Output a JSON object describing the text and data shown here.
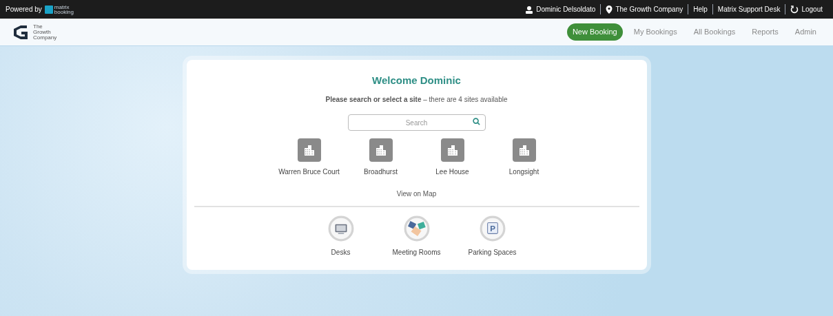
{
  "top_bar": {
    "powered_by": "Powered by",
    "brand": {
      "word1": "matrix",
      "word2": "booking"
    },
    "links": [
      {
        "kind": "user",
        "label": "Dominic Delsoldato"
      },
      {
        "kind": "location",
        "label": "The Growth Company"
      },
      {
        "kind": "text",
        "label": "Help"
      },
      {
        "kind": "text",
        "label": "Matrix Support Desk"
      },
      {
        "kind": "logout",
        "label": "Logout"
      }
    ]
  },
  "header": {
    "logo_lines": [
      "The",
      "Growth",
      "Company"
    ],
    "nav": [
      {
        "label": "New Booking",
        "selected": true
      },
      {
        "label": "My Bookings",
        "selected": false
      },
      {
        "label": "All Bookings",
        "selected": false
      },
      {
        "label": "Reports",
        "selected": false
      },
      {
        "label": "Admin",
        "selected": false
      }
    ]
  },
  "welcome": {
    "title": "Welcome Dominic",
    "subtitle": "**Please search or select a site** – there are 4 sites available",
    "search": {
      "placeholder": "Search"
    },
    "sites": [
      {
        "name": "Warren Bruce Court"
      },
      {
        "name": "Broadhurst"
      },
      {
        "name": "Lee House"
      },
      {
        "name": "Longsight"
      }
    ],
    "map_link": "View on Map",
    "resources": [
      {
        "kind": "desk",
        "label": "Desks"
      },
      {
        "kind": "meeting",
        "label": "Meeting Rooms"
      },
      {
        "kind": "parking",
        "label": "Parking Spaces",
        "badge": "P"
      }
    ]
  }
}
